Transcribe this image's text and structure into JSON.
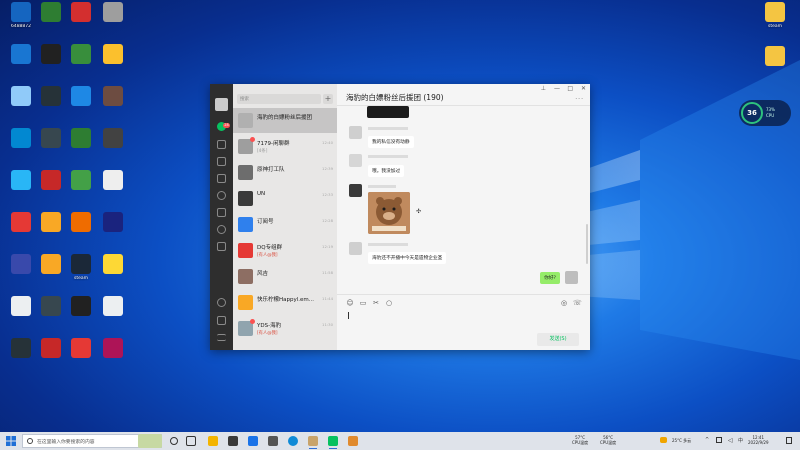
{
  "desktop": {
    "icons": [
      {
        "label": "6488872",
        "color": "#1565c0"
      },
      {
        "label": "",
        "color": "#2e7d32"
      },
      {
        "label": "",
        "color": "#d32f2f"
      },
      {
        "label": "",
        "color": "#9e9e9e"
      },
      {
        "label": "",
        "color": "#1976d2"
      },
      {
        "label": "",
        "color": "#212121"
      },
      {
        "label": "",
        "color": "#388e3c"
      },
      {
        "label": "",
        "color": "#fbc02d"
      },
      {
        "label": "",
        "color": "#90caf9"
      },
      {
        "label": "",
        "color": "#263238"
      },
      {
        "label": "",
        "color": "#1e88e5"
      },
      {
        "label": "",
        "color": "#6d4c41"
      },
      {
        "label": "",
        "color": "#0288d1"
      },
      {
        "label": "",
        "color": "#37474f"
      },
      {
        "label": "",
        "color": "#2e7d32"
      },
      {
        "label": "",
        "color": "#424242"
      },
      {
        "label": "",
        "color": "#29b6f6"
      },
      {
        "label": "",
        "color": "#c62828"
      },
      {
        "label": "",
        "color": "#43a047"
      },
      {
        "label": "",
        "color": "#eeeeee"
      },
      {
        "label": "",
        "color": "#e53935"
      },
      {
        "label": "",
        "color": "#f9a825"
      },
      {
        "label": "",
        "color": "#ef6c00"
      },
      {
        "label": "",
        "color": "#1a237e"
      },
      {
        "label": "",
        "color": "#3949ab"
      },
      {
        "label": "",
        "color": "#f9a825"
      },
      {
        "label": "steam",
        "color": "#1b2838"
      },
      {
        "label": "",
        "color": "#fdd835"
      },
      {
        "label": "",
        "color": "#eceff1"
      },
      {
        "label": "",
        "color": "#37474f"
      },
      {
        "label": "",
        "color": "#212121"
      },
      {
        "label": "",
        "color": "#eceff1"
      },
      {
        "label": "",
        "color": "#263238"
      },
      {
        "label": "",
        "color": "#c62828"
      },
      {
        "label": "",
        "color": "#e53935"
      },
      {
        "label": "",
        "color": "#ad1457"
      },
      {
        "label": "steam",
        "color": "#f4c542"
      },
      {
        "label": "",
        "color": "#f4c542"
      }
    ]
  },
  "cpu_widget": {
    "value": "36",
    "unit": "%",
    "line1": "73%",
    "line2": "CPU"
  },
  "wechat": {
    "search_placeholder": "搜索",
    "plus": "+",
    "conversations": [
      {
        "name": "海豹的白嫖粉丝后援团",
        "preview": "",
        "time": "",
        "color": "#b0b0b0",
        "selected": true
      },
      {
        "name": "7179-闲聊群",
        "preview": "[4条]",
        "time": "12:40",
        "color": "#9e9e9e",
        "dot": true
      },
      {
        "name": "原神打工队",
        "preview": "",
        "time": "12:39",
        "color": "#6d6d6d"
      },
      {
        "name": "UN",
        "preview": "",
        "time": "12:33",
        "color": "#3a3a3a"
      },
      {
        "name": "订阅号",
        "preview": "",
        "time": "12:28",
        "color": "#2f80ed"
      },
      {
        "name": "DQ专组群",
        "preview_at": "[有人@我]",
        "preview": "",
        "time": "12:19",
        "color": "#e53935"
      },
      {
        "name": "风吉",
        "preview": "",
        "time": "11:58",
        "color": "#8d6e63"
      },
      {
        "name": "快乐柠檬Happyl.em...",
        "preview": "",
        "time": "11:44",
        "color": "#f9a825"
      },
      {
        "name": "YDS-海豹",
        "preview_at": "[有人@我]",
        "preview": "",
        "time": "11:30",
        "color": "#90a4ae",
        "dot": true
      }
    ],
    "chat_title": "海豹的白嫖粉丝后援团 (190)",
    "controls": {
      "min": "—",
      "max": "□",
      "close": "✕",
      "pin": "⊥",
      "more": "···"
    },
    "messages": [
      {
        "nick": "",
        "text": "我的私信没有动静"
      },
      {
        "nick": "",
        "text": "哦。我没加过"
      },
      {
        "nick": "",
        "text": ""
      },
      {
        "nick": "",
        "text": "海豹还不开播中今天是遗物企业圣"
      }
    ],
    "my_message": "你好?",
    "send_label": "发送(S)"
  },
  "taskbar": {
    "search_placeholder": "在这里输入你要搜索的内容",
    "temp1_value": "57°C",
    "temp1_label": "CPU温度",
    "temp2_value": "56°C",
    "temp2_label": "CPU温度",
    "weather": "25°C 多云",
    "time": "12:41",
    "date": "2022/9/29"
  },
  "colors": {
    "wechat_green": "#07c160",
    "accent_blue": "#0c4fc4",
    "badge_red": "#fa5151"
  }
}
